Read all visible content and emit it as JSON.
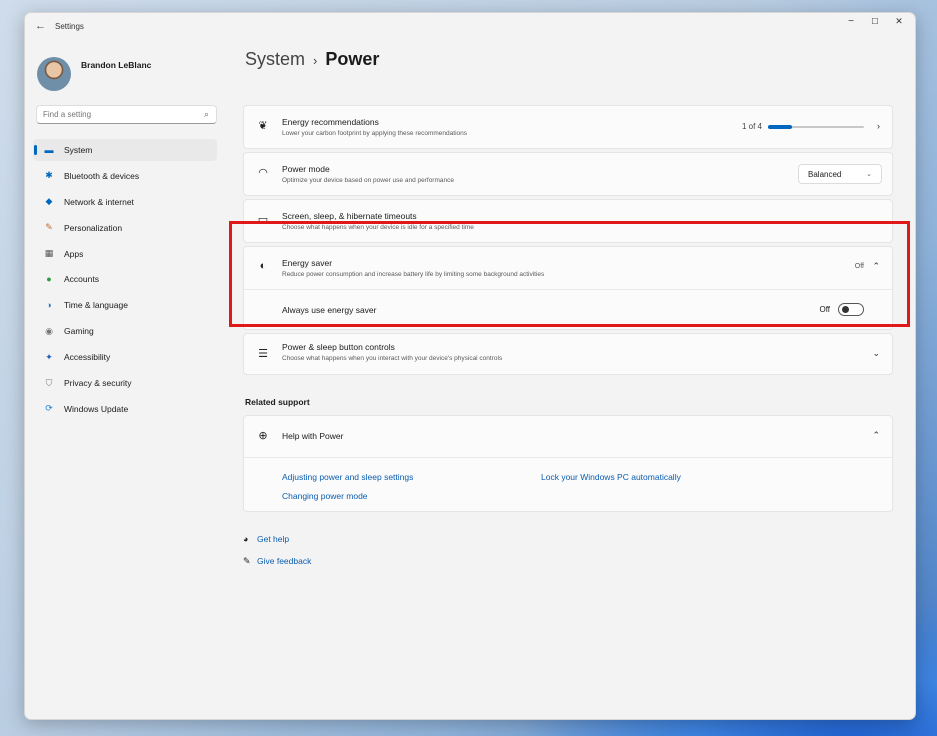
{
  "window": {
    "app_title": "Settings",
    "back_icon": "←",
    "controls": {
      "minimize": "−",
      "maximize": "☐",
      "close": "✕"
    }
  },
  "user": {
    "name": "Brandon LeBlanc"
  },
  "search": {
    "placeholder": "Find a setting",
    "icon": "⌕"
  },
  "nav": {
    "items": [
      {
        "label": "System",
        "icon": "▬",
        "color": "#0067c0",
        "active": true
      },
      {
        "label": "Bluetooth & devices",
        "icon": "✱",
        "color": "#0067c0"
      },
      {
        "label": "Network & internet",
        "icon": "◆",
        "color": "#0067c0"
      },
      {
        "label": "Personalization",
        "icon": "✎",
        "color": "#c26a2d"
      },
      {
        "label": "Apps",
        "icon": "▦",
        "color": "#555555"
      },
      {
        "label": "Accounts",
        "icon": "●",
        "color": "#2e9a4a"
      },
      {
        "label": "Time & language",
        "icon": "◑",
        "color": "#1b7fd1"
      },
      {
        "label": "Gaming",
        "icon": "◉",
        "color": "#777777"
      },
      {
        "label": "Accessibility",
        "icon": "✦",
        "color": "#1f5fbf"
      },
      {
        "label": "Privacy & security",
        "icon": "⛉",
        "color": "#7a7a7a"
      },
      {
        "label": "Windows Update",
        "icon": "⟳",
        "color": "#1b7fd1"
      }
    ]
  },
  "breadcrumb": {
    "parent": "System",
    "separator": "›",
    "current": "Power"
  },
  "settings": {
    "energy_recommendations": {
      "title": "Energy recommendations",
      "desc": "Lower your carbon footprint by applying these recommendations",
      "progress_text": "1 of 4",
      "progress": 0.25
    },
    "power_mode": {
      "title": "Power mode",
      "desc": "Optimize your device based on power use and performance",
      "value": "Balanced"
    },
    "timeouts": {
      "title": "Screen, sleep, & hibernate timeouts",
      "desc": "Choose what happens when your device is idle for a specified time"
    },
    "energy_saver": {
      "title": "Energy saver",
      "desc": "Reduce power consumption and increase battery life by limiting some background activities",
      "status": "Off",
      "always_label": "Always use energy saver",
      "toggle_label": "Off",
      "toggle_on": false
    },
    "button_controls": {
      "title": "Power & sleep button controls",
      "desc": "Choose what happens when you interact with your device's physical controls"
    }
  },
  "related": {
    "heading": "Related support",
    "help_title": "Help with Power",
    "links": [
      "Adjusting power and sleep settings",
      "Lock your Windows PC automatically",
      "Changing power mode"
    ]
  },
  "footer": {
    "get_help": "Get help",
    "give_feedback": "Give feedback"
  },
  "colors": {
    "accent": "#0067c0",
    "highlight": "#e01818"
  }
}
